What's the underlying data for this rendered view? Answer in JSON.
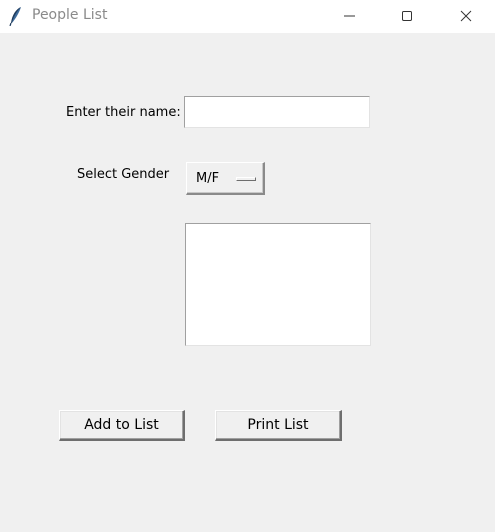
{
  "window": {
    "title": "People List",
    "icon": "feather-icon",
    "controls": [
      "minimize-icon",
      "maximize-icon",
      "close-icon"
    ]
  },
  "form": {
    "name_label": "Enter their name:",
    "name_value": "",
    "gender_label": "Select Gender",
    "gender_selected": "M/F",
    "listbox_items": []
  },
  "buttons": {
    "add_label": "Add to List",
    "print_label": "Print List"
  }
}
